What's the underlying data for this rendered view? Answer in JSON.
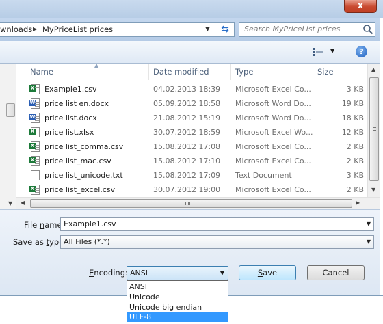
{
  "titlebar": {
    "close_glyph": "x"
  },
  "address": {
    "crumbs": [
      "wnloads",
      "MyPriceList prices"
    ],
    "separator": "▶",
    "dropdown_glyph": "▼",
    "refresh_glyph": "⇆"
  },
  "search": {
    "placeholder": "Search MyPriceList prices"
  },
  "toolbar": {
    "views_glyph": "▼",
    "help_glyph": "?"
  },
  "columns": {
    "name": "Name",
    "date": "Date modified",
    "type": "Type",
    "size": "Size"
  },
  "files": [
    {
      "icon": "excel-file-icon",
      "name": "Example1.csv",
      "date": "04.02.2013 18:39",
      "type": "Microsoft Excel Co...",
      "size": "3 KB"
    },
    {
      "icon": "word-file-icon",
      "name": "price list en.docx",
      "date": "05.09.2012 18:58",
      "type": "Microsoft Word Do...",
      "size": "19 KB"
    },
    {
      "icon": "word-file-icon",
      "name": "price list.docx",
      "date": "21.08.2012 15:19",
      "type": "Microsoft Word Do...",
      "size": "18 KB"
    },
    {
      "icon": "excel-file-icon",
      "name": "price list.xlsx",
      "date": "30.07.2012 18:59",
      "type": "Microsoft Excel Wo...",
      "size": "12 KB"
    },
    {
      "icon": "excel-file-icon",
      "name": "price list_comma.csv",
      "date": "15.08.2012 17:08",
      "type": "Microsoft Excel Co...",
      "size": "2 KB"
    },
    {
      "icon": "excel-file-icon",
      "name": "price list_mac.csv",
      "date": "15.08.2012 17:10",
      "type": "Microsoft Excel Co...",
      "size": "2 KB"
    },
    {
      "icon": "text-file-icon",
      "name": "price list_unicode.txt",
      "date": "15.08.2012 17:09",
      "type": "Text Document",
      "size": "3 KB"
    },
    {
      "icon": "excel-file-icon",
      "name": "price list_excel.csv",
      "date": "30.07.2012 19:00",
      "type": "Microsoft Excel Co...",
      "size": "2 KB"
    }
  ],
  "form": {
    "filename_label_pre": "File ",
    "filename_label_u": "n",
    "filename_label_post": "ame:",
    "filename_value": "Example1.csv",
    "savetype_label_pre": "Save as ",
    "savetype_label_u": "t",
    "savetype_label_post": "ype:",
    "savetype_value": "All Files  (*.*)",
    "encoding_label_pre": "",
    "encoding_label_u": "E",
    "encoding_label_post": "ncoding:",
    "encoding_value": "ANSI",
    "encoding_options": [
      "ANSI",
      "Unicode",
      "Unicode big endian",
      "UTF-8"
    ],
    "encoding_highlighted": "UTF-8",
    "save_u": "S",
    "save_post": "ave",
    "cancel_label": "Cancel",
    "dropdown_glyph": "▼"
  },
  "scroll": {
    "up": "▲",
    "down": "▼",
    "left": "◀",
    "right": "▶"
  }
}
